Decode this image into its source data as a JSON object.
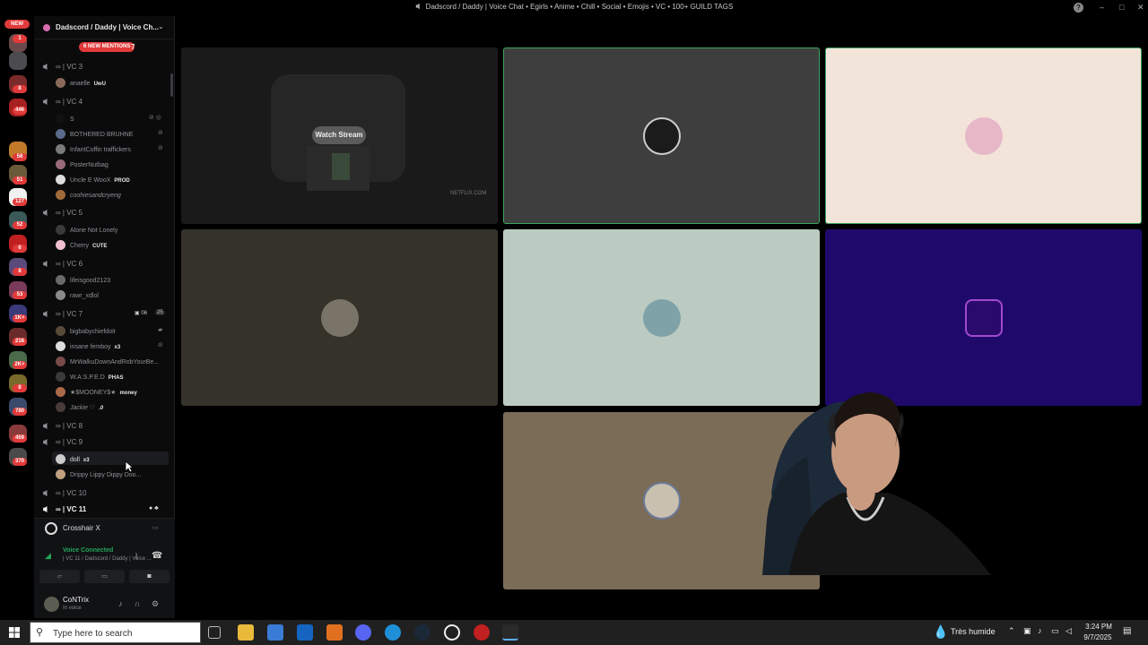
{
  "window": {
    "title": "Dadscord / Daddy | Voice Chat • Egirls • Anime • Chill • Social • Emojis • VC • 100+ GUILD TAGS"
  },
  "rail": {
    "new_label": "NEW",
    "badges": [
      "1",
      "8",
      "446",
      "58",
      "51",
      "127",
      "52",
      "6",
      "8",
      "53",
      "1K+",
      "216",
      "2K+",
      "8",
      "780",
      "459",
      "370"
    ]
  },
  "sidebar": {
    "guild_name": "Dadscord / Daddy | Voice Ch...",
    "mentions_label": "6 NEW MENTIONS",
    "mentions_extra": "7",
    "channels": [
      {
        "name": "VC 3",
        "users": [
          {
            "name": "anaelle",
            "tag": "UwU"
          }
        ]
      },
      {
        "name": "VC 4",
        "users": [
          {
            "name": "S",
            "tag": ""
          },
          {
            "name": "BOTHERED BRUHNE",
            "tag": ""
          },
          {
            "name": "InfantCoffin traffickers",
            "tag": ""
          },
          {
            "name": "PosterNutbag",
            "tag": ""
          },
          {
            "name": "Uncle E WooX",
            "tag": "PROD"
          },
          {
            "name": "coohiesandcryeng",
            "tag": ""
          }
        ]
      },
      {
        "name": "VC 5",
        "users": [
          {
            "name": "Alone Not Lonely",
            "tag": ""
          },
          {
            "name": "Cherry",
            "tag": "CUTE"
          }
        ]
      },
      {
        "name": "VC 6",
        "users": [
          {
            "name": "lifeisgood2123",
            "tag": ""
          },
          {
            "name": "rawr_xdlol",
            "tag": ""
          }
        ]
      },
      {
        "name": "VC 7",
        "counts": [
          "06",
          "25"
        ],
        "users": [
          {
            "name": "bigbabychiefdoit",
            "tag": ""
          },
          {
            "name": "insane femboy",
            "tag": "x3"
          },
          {
            "name": "MrWalkuDownAndRobYourBe...",
            "tag": ""
          },
          {
            "name": "W.A.S.P.E.D",
            "tag": "PHAS"
          },
          {
            "name": "★$MOONEY$★",
            "tag": "money"
          },
          {
            "name": "Jackie ♡",
            "tag": ".0"
          }
        ]
      },
      {
        "name": "VC 8",
        "users": []
      },
      {
        "name": "VC 9",
        "users": [
          {
            "name": "doll",
            "tag": "x3"
          },
          {
            "name": "Drippy Lippy Dippy Doo...",
            "tag": ""
          }
        ]
      },
      {
        "name": "VC 10",
        "users": []
      },
      {
        "name": "VC 11",
        "users": []
      }
    ]
  },
  "panel": {
    "activity": "Crosshair X",
    "voice_status": "Voice Connected",
    "voice_channel": "| VC 11 / Dadscord / Daddy | Voice ...",
    "username": "CoNTrix",
    "user_status": "In voice"
  },
  "stage": {
    "watch_stream_label": "Watch Stream",
    "stream_watermark": "NETFLIX.COM",
    "tile_colors": [
      "#1c1c1c",
      "#3e3e3e",
      "#f3e4da",
      "#35322a",
      "#bccbc1",
      "#1f0a6b",
      "#7b6c58"
    ]
  },
  "taskbar": {
    "search_placeholder": "Type here to search",
    "weather": "Très humide",
    "time": "3:24 PM",
    "date": "9/7/2025"
  },
  "colors": {
    "discord_red": "#e23a3a",
    "voice_green": "#23a55a",
    "speaking_outline": "#3ba55c"
  }
}
